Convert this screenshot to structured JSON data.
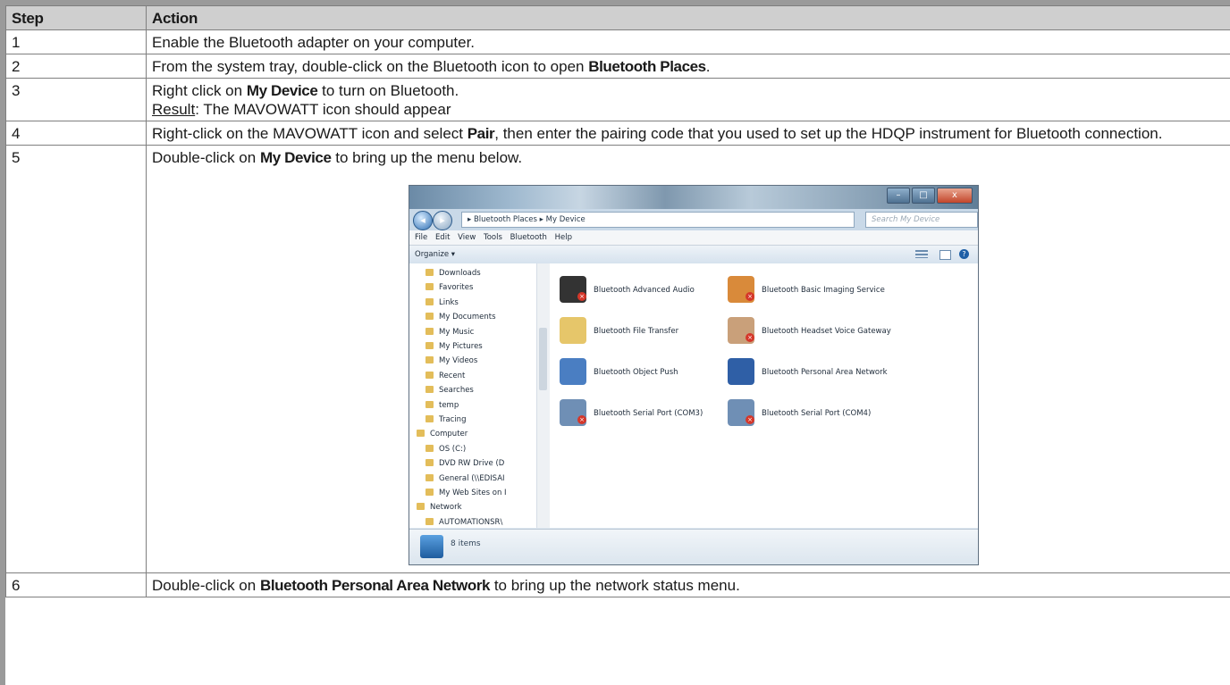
{
  "table": {
    "headers": [
      "Step",
      "Action"
    ],
    "rows": [
      {
        "step": "1",
        "action": "Enable the Bluetooth adapter on your computer."
      },
      {
        "step": "2",
        "action_pre": "From the system tray, double-click on the Bluetooth icon to open ",
        "action_bold": "Bluetooth Places",
        "action_post": "."
      },
      {
        "step": "3",
        "action_pre": "Right click on ",
        "action_bold": "My Device",
        "action_post": " to turn on Bluetooth.",
        "result_label": "Result",
        "result_text": ": The MAVOWATT icon should appear"
      },
      {
        "step": "4",
        "action_pre": "Right-click on the MAVOWATT icon and select ",
        "action_bold": "Pair",
        "action_post": ", then enter the pairing code that you used to set up the HDQP instrument for Bluetooth connection."
      },
      {
        "step": "5",
        "action_pre": "Double-click on ",
        "action_bold": "My Device",
        "action_post": " to bring up the menu below."
      },
      {
        "step": "6",
        "action_pre": "Double-click on ",
        "action_bold": "Bluetooth Personal Area Network",
        "action_post": " to bring up the network status menu."
      }
    ]
  },
  "screenshot": {
    "breadcrumb": "▸ Bluetooth Places ▸ My Device",
    "search_placeholder": "Search My Device",
    "menu": [
      "File",
      "Edit",
      "View",
      "Tools",
      "Bluetooth",
      "Help"
    ],
    "organize": "Organize ▾",
    "nav_items": [
      "Downloads",
      "Favorites",
      "Links",
      "My Documents",
      "My Music",
      "My Pictures",
      "My Videos",
      "Recent",
      "Searches",
      "temp",
      "Tracing",
      "Computer",
      "OS (C:)",
      "DVD RW Drive (D",
      "General (\\\\EDISAI",
      "My Web Sites on I",
      "Network",
      "AUTOMATIONSR\\"
    ],
    "services": [
      {
        "label": "Bluetooth Advanced Audio",
        "color": "#333333"
      },
      {
        "label": "Bluetooth Basic Imaging Service",
        "color": "#d98a3a"
      },
      {
        "label": "Bluetooth File Transfer",
        "color": "#e6c66a"
      },
      {
        "label": "Bluetooth Headset Voice Gateway",
        "color": "#c9a07a"
      },
      {
        "label": "Bluetooth Object Push",
        "color": "#4a7ec2"
      },
      {
        "label": "Bluetooth Personal Area Network",
        "color": "#2f5fa6"
      },
      {
        "label": "Bluetooth Serial Port (COM3)",
        "color": "#6f8fb5"
      },
      {
        "label": "Bluetooth Serial Port (COM4)",
        "color": "#6f8fb5"
      }
    ],
    "status": "8 items"
  }
}
